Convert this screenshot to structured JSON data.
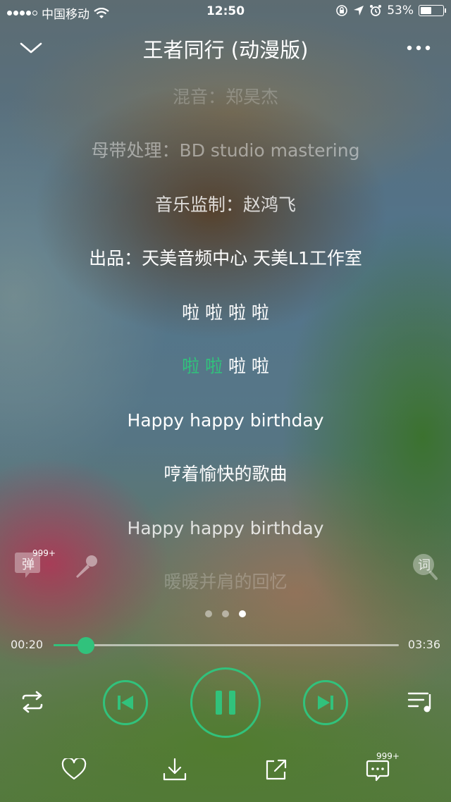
{
  "status_bar": {
    "carrier": "中国移动",
    "time": "12:50",
    "battery": "53%",
    "battery_level": 0.53
  },
  "header": {
    "title": "王者同行 (动漫版)"
  },
  "lyrics": [
    "混音：郑昊杰",
    "母带处理：BD studio mastering",
    "音乐监制：赵鸿飞",
    "出品：天美音频中心 天美L1工作室",
    "啦 啦 啦 啦",
    "啦 啦 啦 啦",
    "Happy happy birthday",
    "哼着愉快的歌曲",
    "Happy happy birthday",
    "暖暖并肩的回忆"
  ],
  "active_lyric": {
    "sung": "啦 啦",
    "unsung": "啦 啦"
  },
  "side": {
    "danmu_label": "弹",
    "danmu_count": "999+",
    "lyric_search_label": "词"
  },
  "page_dots": {
    "count": 3,
    "active": 2
  },
  "player": {
    "elapsed": "00:20",
    "duration": "03:36",
    "progress": 0.093
  },
  "comments_count": "999+",
  "colors": {
    "accent": "#31c27c"
  }
}
